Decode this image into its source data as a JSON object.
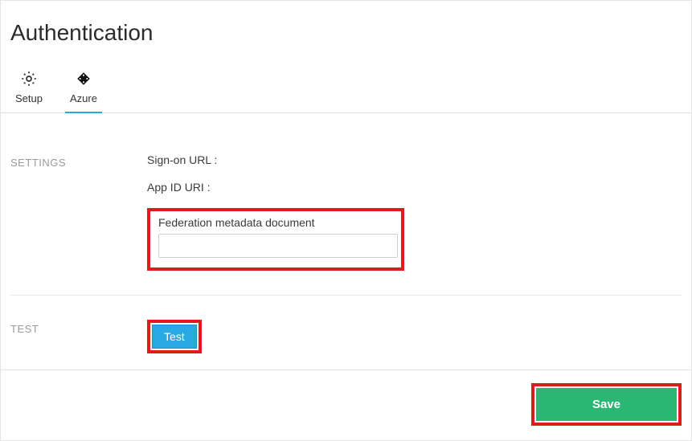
{
  "page": {
    "title": "Authentication"
  },
  "tabs": {
    "setup": "Setup",
    "azure": "Azure"
  },
  "settings": {
    "section_label": "SETTINGS",
    "sign_on_url_label": "Sign-on URL :",
    "app_id_uri_label": "App ID URI :",
    "federation_label": "Federation metadata document",
    "federation_value": ""
  },
  "test": {
    "section_label": "TEST",
    "button_label": "Test"
  },
  "footer": {
    "save_label": "Save"
  }
}
